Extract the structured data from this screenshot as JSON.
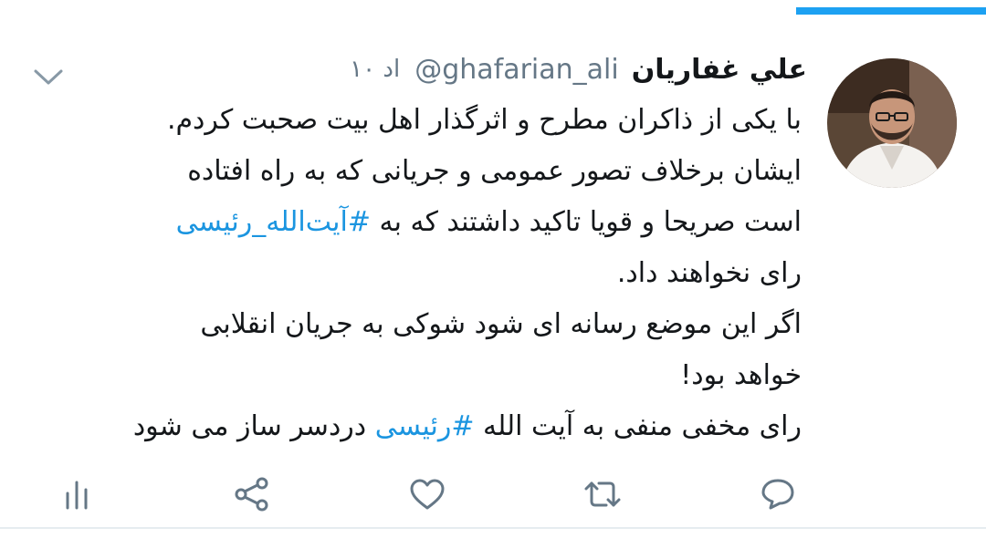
{
  "tweet": {
    "display_name": "علي غفاريان",
    "handle": "@ghafarian_ali",
    "time": "۱۰ اد",
    "text": {
      "line1": "با یکی از ذاکران مطرح و اثرگذار اهل بیت صحبت کردم.",
      "line2": "ایشان برخلاف تصور عمومی و جریانی که به راه افتاده",
      "line3_before": "است صریحا و قویا تاکید داشتند که به ",
      "line3_hashtag": "#آیت‌الله_رئیسی",
      "line4": "رای نخواهند داد.",
      "line5": "اگر این موضع رسانه ای شود شوکی به جریان انقلابی",
      "line6": "خواهد بود!",
      "line7_before": "رای مخفی منفی به آیت الله ",
      "line7_hashtag": "#رئیسی",
      "line7_after": " دردسر ساز می شود"
    }
  },
  "icons": {
    "caret": "chevron-down-icon",
    "reply": "reply-icon",
    "retweet": "retweet-icon",
    "like": "like-icon",
    "share": "share-icon",
    "analytics": "analytics-icon"
  },
  "colors": {
    "accent": "#1da1f2",
    "hashtag": "#1b95e0",
    "text": "#14171a",
    "muted": "#657786",
    "icon": "#657786",
    "divider": "#e6ecf0"
  }
}
